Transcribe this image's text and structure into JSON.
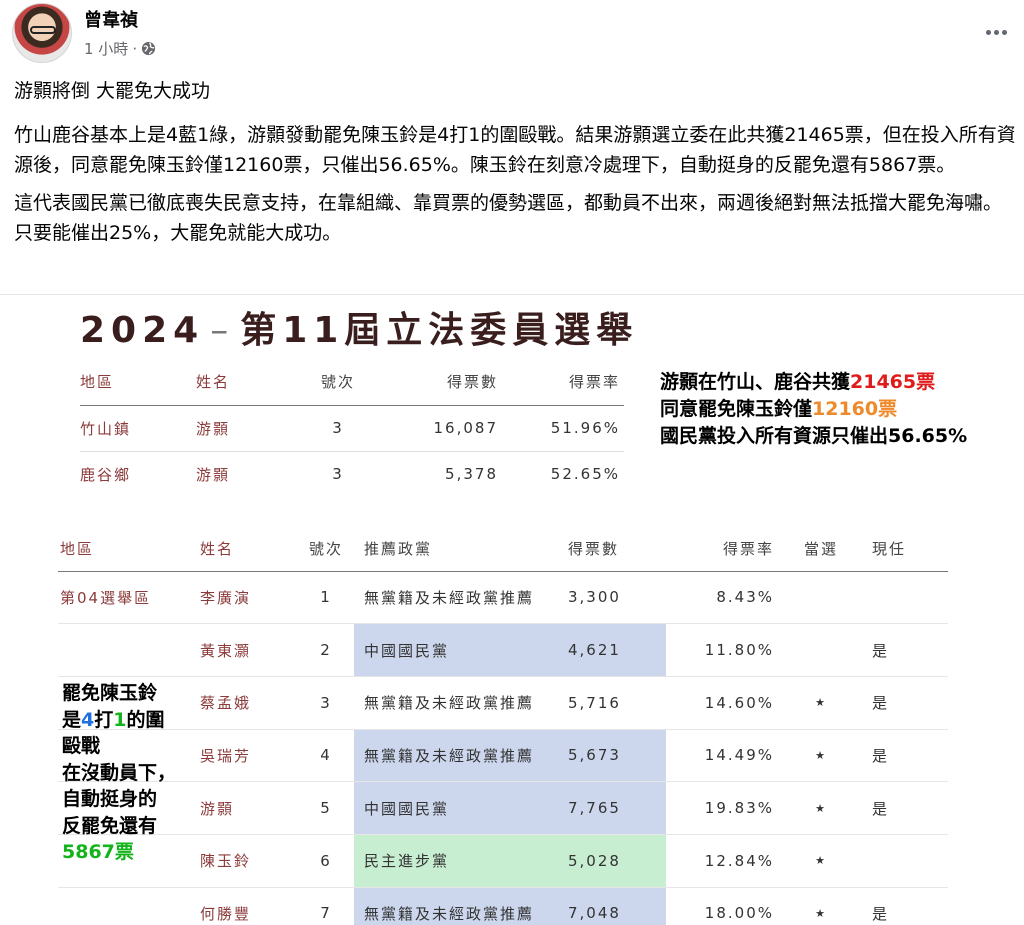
{
  "post": {
    "author": "曾韋禎",
    "time": "1 小時",
    "dot": "·",
    "headline": "游顥將倒 大罷免大成功",
    "para1": "竹山鹿谷基本上是4藍1綠，游顥發動罷免陳玉鈴是4打1的圍毆戰。結果游顥選立委在此共獲21465票，但在投入所有資源後，同意罷免陳玉鈴僅12160票，只催出56.65%。陳玉鈴在刻意冷處理下，自動挺身的反罷免還有5867票。",
    "para2": "這代表國民黨已徹底喪失民意支持，在靠組織、靠買票的優勢選區，都動員不出來，兩週後絕對無法抵擋大罷免海嘯。只要能催出25%，大罷免就能大成功。"
  },
  "image": {
    "title_year": "2024",
    "title_dash": "–",
    "title_main": "第11屆立法委員選舉",
    "table1": {
      "headers": [
        "地區",
        "姓名",
        "號次",
        "得票數",
        "得票率"
      ],
      "rows": [
        [
          "竹山鎮",
          "游顥",
          "3",
          "16,087",
          "51.96%"
        ],
        [
          "鹿谷鄉",
          "游顥",
          "3",
          "5,378",
          "52.65%"
        ]
      ]
    },
    "summary": {
      "line1_a": "游顥在竹山、鹿谷共獲",
      "line1_b": "21465票",
      "line2_a": "同意罷免陳玉鈴僅",
      "line2_b": "12160票",
      "line3": "國民黨投入所有資源只催出56.65%"
    },
    "table2": {
      "headers": [
        "地區",
        "姓名",
        "號次",
        "推薦政黨",
        "得票數",
        "得票率",
        "當選",
        "現任"
      ],
      "rows": [
        [
          "第04選舉區",
          "李廣演",
          "1",
          "無黨籍及未經政黨推薦",
          "3,300",
          "8.43%",
          "",
          ""
        ],
        [
          "",
          "黃東灝",
          "2",
          "中國國民黨",
          "4,621",
          "11.80%",
          "",
          "是"
        ],
        [
          "",
          "蔡孟娥",
          "3",
          "無黨籍及未經政黨推薦",
          "5,716",
          "14.60%",
          "★",
          "是"
        ],
        [
          "",
          "吳瑞芳",
          "4",
          "無黨籍及未經政黨推薦",
          "5,673",
          "14.49%",
          "★",
          "是"
        ],
        [
          "",
          "游顥",
          "5",
          "中國國民黨",
          "7,765",
          "19.83%",
          "★",
          "是"
        ],
        [
          "",
          "陳玉鈴",
          "6",
          "民主進步黨",
          "5,028",
          "12.84%",
          "★",
          ""
        ],
        [
          "",
          "何勝豐",
          "7",
          "無黨籍及未經政黨推薦",
          "7,048",
          "18.00%",
          "★",
          "是"
        ]
      ]
    },
    "side_note": {
      "l1": "罷免陳玉鈴",
      "l2_a": "是",
      "l2_b": "4",
      "l2_c": "打",
      "l2_d": "1",
      "l2_e": "的圍",
      "l3": "毆戰",
      "l4": "在沒動員下，",
      "l5": "自動挺身的",
      "l6": "反罷免還有",
      "l7": "5867票"
    }
  },
  "colors": {
    "kmt_highlight": "#ccd7ee",
    "dpp_highlight": "#c8eed2",
    "red_text": "#e01b1b",
    "orange_text": "#ef8a2b",
    "blue_text": "#1e6fe0",
    "green_text": "#15b31b"
  }
}
